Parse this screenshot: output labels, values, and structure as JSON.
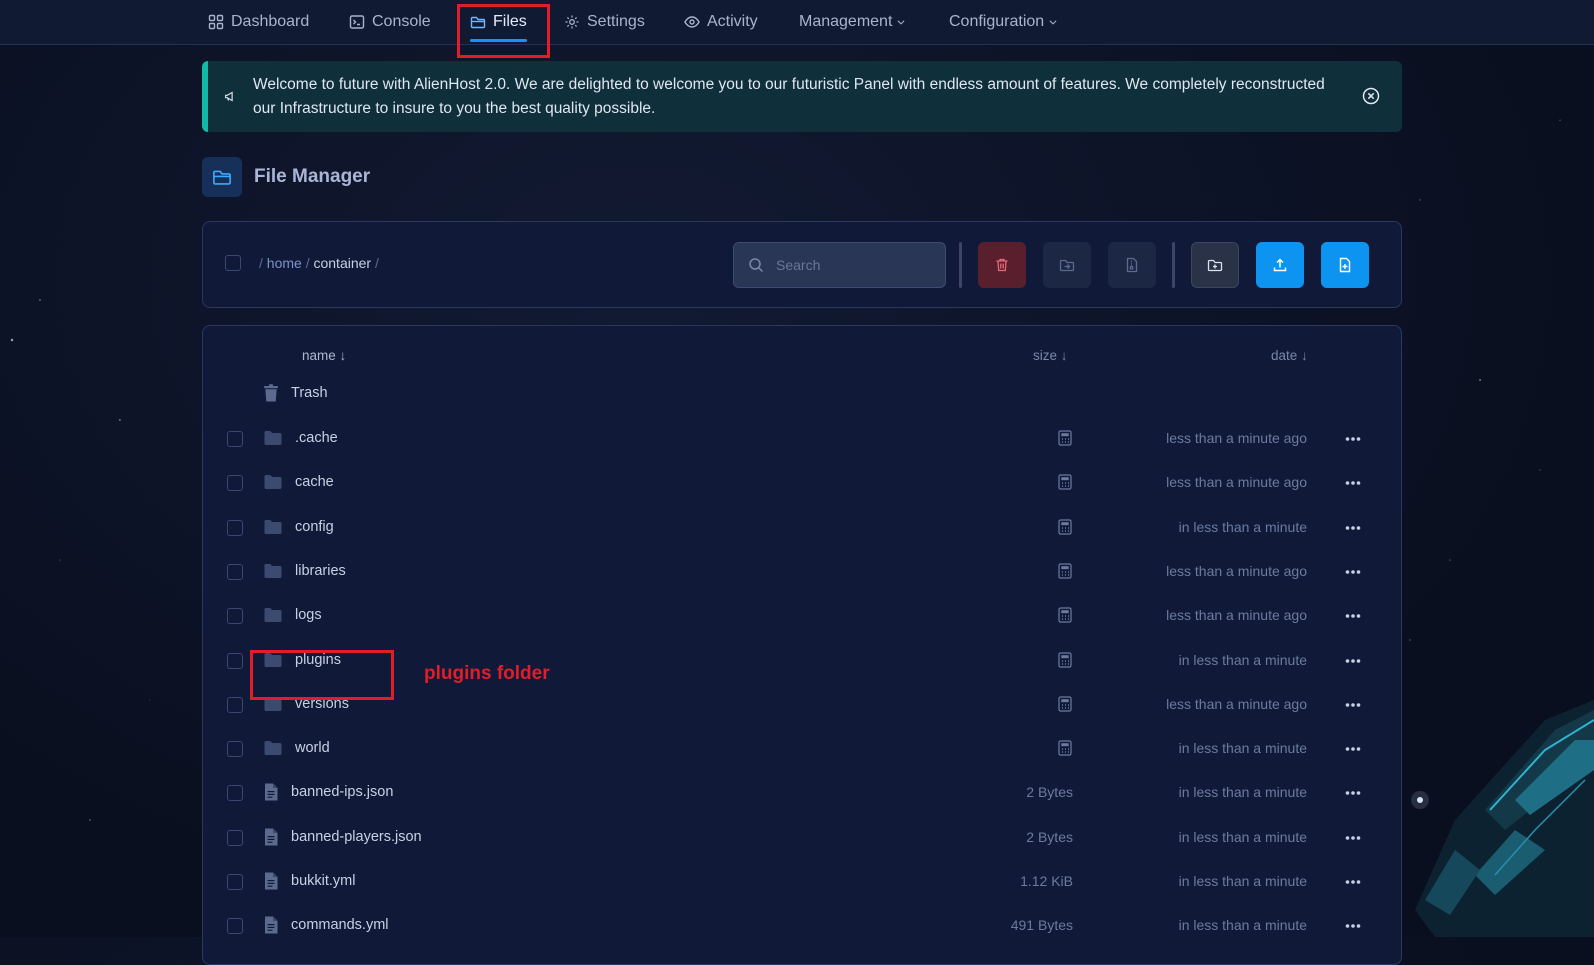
{
  "nav": {
    "items": [
      {
        "label": "Dashboard",
        "icon": "grid-icon"
      },
      {
        "label": "Console",
        "icon": "terminal-icon"
      },
      {
        "label": "Files",
        "icon": "folder-open-icon",
        "active": true
      },
      {
        "label": "Settings",
        "icon": "gear-icon"
      },
      {
        "label": "Activity",
        "icon": "eye-icon"
      },
      {
        "label": "Management",
        "icon": "chevron-down-icon"
      },
      {
        "label": "Configuration",
        "icon": "chevron-down-icon"
      }
    ]
  },
  "announcement": {
    "text": "Welcome to future with AlienHost 2.0. We are delighted to welcome you to our futuristic Panel with endless amount of features. We completely reconstructed our Infrastructure to insure to you the best quality possible."
  },
  "header": {
    "title": "File Manager"
  },
  "toolbar": {
    "breadcrumb": {
      "sep": "/",
      "home": "home",
      "current": "container"
    },
    "search_placeholder": "Search"
  },
  "columns": {
    "name": "name ↓",
    "size": "size ↓",
    "date": "date ↓"
  },
  "trash": {
    "label": "Trash"
  },
  "files": [
    {
      "name": ".cache",
      "type": "folder",
      "size": "",
      "date": "less than a minute ago"
    },
    {
      "name": "cache",
      "type": "folder",
      "size": "",
      "date": "less than a minute ago"
    },
    {
      "name": "config",
      "type": "folder",
      "size": "",
      "date": "in less than a minute"
    },
    {
      "name": "libraries",
      "type": "folder",
      "size": "",
      "date": "less than a minute ago"
    },
    {
      "name": "logs",
      "type": "folder",
      "size": "",
      "date": "less than a minute ago"
    },
    {
      "name": "plugins",
      "type": "folder",
      "size": "",
      "date": "in less than a minute"
    },
    {
      "name": "versions",
      "type": "folder",
      "size": "",
      "date": "less than a minute ago"
    },
    {
      "name": "world",
      "type": "folder",
      "size": "",
      "date": "in less than a minute"
    },
    {
      "name": "banned-ips.json",
      "type": "file",
      "size": "2 Bytes",
      "date": "in less than a minute"
    },
    {
      "name": "banned-players.json",
      "type": "file",
      "size": "2 Bytes",
      "date": "in less than a minute"
    },
    {
      "name": "bukkit.yml",
      "type": "file",
      "size": "1.12 KiB",
      "date": "in less than a minute"
    },
    {
      "name": "commands.yml",
      "type": "file",
      "size": "491 Bytes",
      "date": "in less than a minute"
    }
  ],
  "annotation": {
    "label": "plugins folder"
  },
  "colors": {
    "accent": "#1a8fff",
    "highlight": "#e11d2a",
    "announce_border": "#14b8a6",
    "danger_button": "#5a1f2c"
  }
}
